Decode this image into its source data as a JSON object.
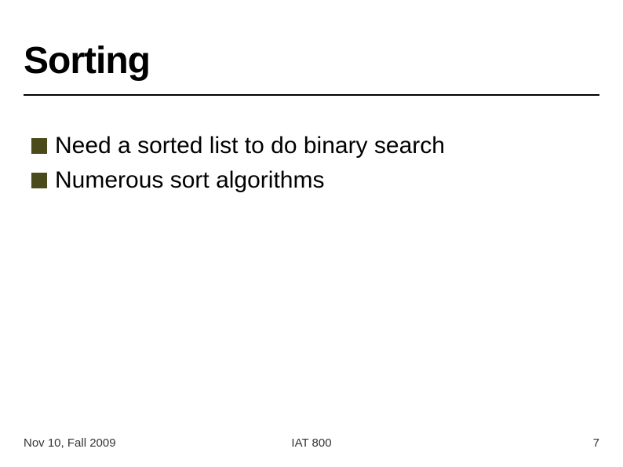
{
  "slide": {
    "title": "Sorting",
    "bullets": [
      "Need a sorted list to do binary search",
      "Numerous sort algorithms"
    ],
    "footer": {
      "left": "Nov 10, Fall 2009",
      "center": "IAT 800",
      "right": "7"
    }
  }
}
